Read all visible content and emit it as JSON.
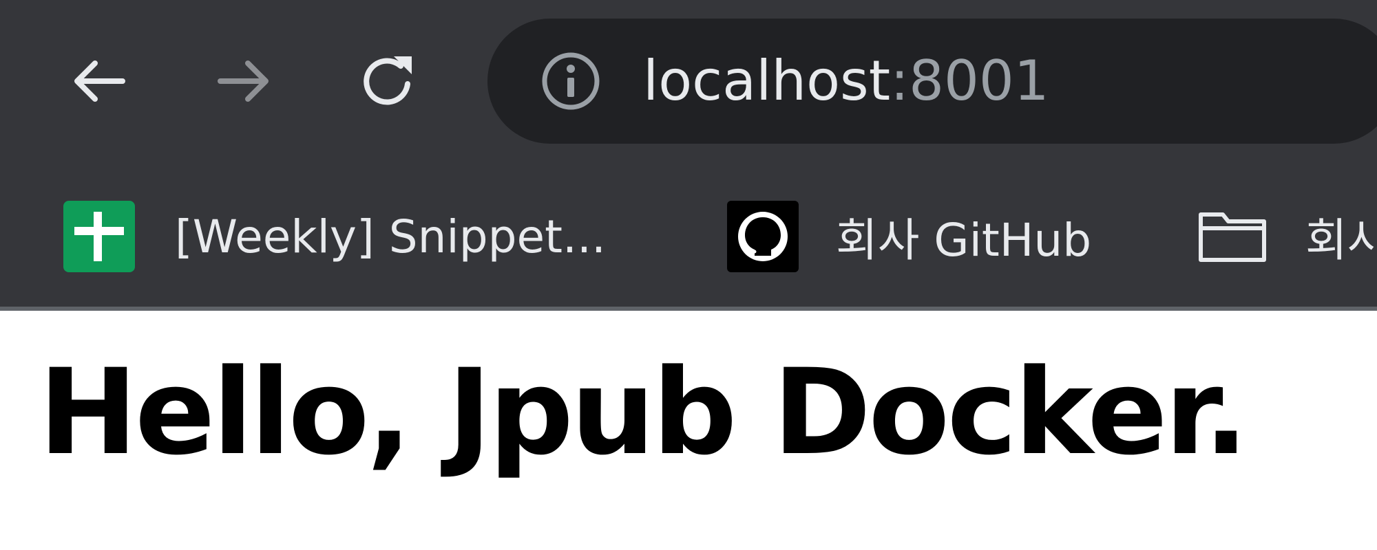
{
  "toolbar": {
    "back_icon": "arrow-left-icon",
    "forward_icon": "arrow-right-icon",
    "reload_icon": "reload-icon",
    "omnibox": {
      "info_icon": "info-icon",
      "host": "localhost",
      "port": ":8001"
    }
  },
  "bookmarks": [
    {
      "icon": "google-sheets-icon",
      "label": "[Weekly] Snippet..."
    },
    {
      "icon": "github-icon",
      "label": "회사 GitHub"
    },
    {
      "icon": "folder-icon",
      "label": "회사"
    }
  ],
  "page": {
    "heading": "Hello, Jpub Docker."
  },
  "colors": {
    "toolbar_bg": "#35363a",
    "omnibox_bg": "#202124",
    "text_light": "#e8eaed",
    "text_dim": "#9aa0a6",
    "sheets_green": "#0f9d58"
  }
}
